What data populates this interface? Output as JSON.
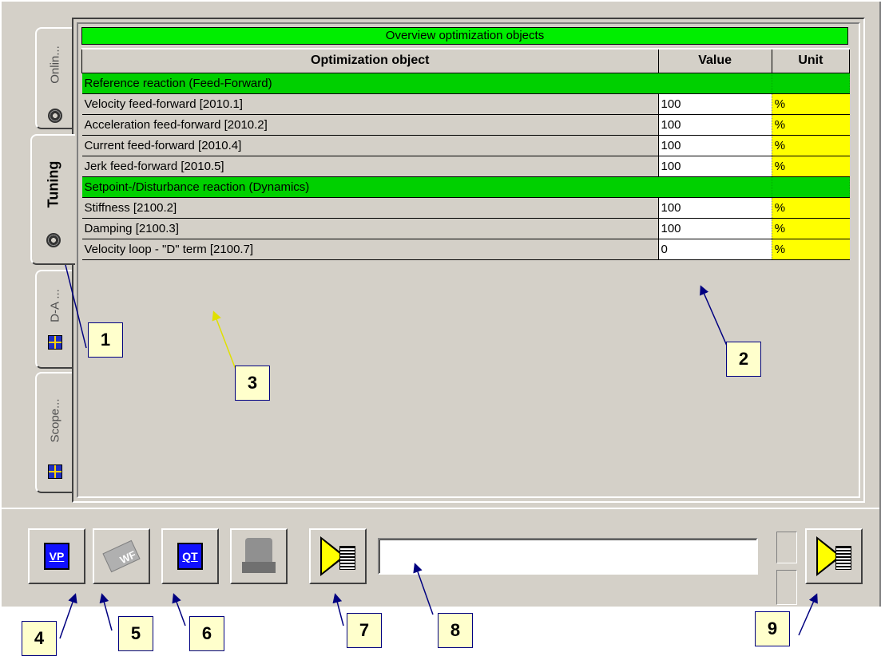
{
  "tabs": [
    {
      "label": "Onlin...",
      "icon": "gear-icon"
    },
    {
      "label": "Tuning",
      "icon": "gear-icon",
      "active": true
    },
    {
      "label": "D-A ...",
      "icon": "grid-icon"
    },
    {
      "label": "Scope...",
      "icon": "grid-icon"
    }
  ],
  "panel": {
    "title": "Overview optimization objects",
    "columns": [
      "Optimization object",
      "Value",
      "Unit"
    ],
    "groups": [
      {
        "label": "Reference reaction (Feed-Forward)",
        "rows": [
          {
            "name": "Velocity feed-forward [2010.1]",
            "value": "100",
            "unit": "%"
          },
          {
            "name": "Acceleration feed-forward [2010.2]",
            "value": "100",
            "unit": "%"
          },
          {
            "name": "Current feed-forward [2010.4]",
            "value": "100",
            "unit": "%"
          },
          {
            "name": "Jerk feed-forward [2010.5]",
            "value": "100",
            "unit": "%"
          }
        ]
      },
      {
        "label": "Setpoint-/Disturbance reaction (Dynamics)",
        "rows": [
          {
            "name": "Stiffness [2100.2]",
            "value": "100",
            "unit": "%"
          },
          {
            "name": "Damping [2100.3]",
            "value": "100",
            "unit": "%"
          },
          {
            "name": "Velocity loop - \"D\" term [2100.7]",
            "value": "0",
            "unit": "%"
          }
        ]
      }
    ]
  },
  "toolbar": {
    "vp_label": "VP",
    "wf_label": "WF",
    "qt_label": "QT",
    "status_text": ""
  },
  "callouts": [
    "1",
    "2",
    "3",
    "4",
    "5",
    "6",
    "7",
    "8",
    "9"
  ],
  "colors": {
    "group_green": "#00d000",
    "title_green": "#00ee00",
    "unit_yellow": "#ffff00",
    "callout_bg": "#ffffcc"
  }
}
